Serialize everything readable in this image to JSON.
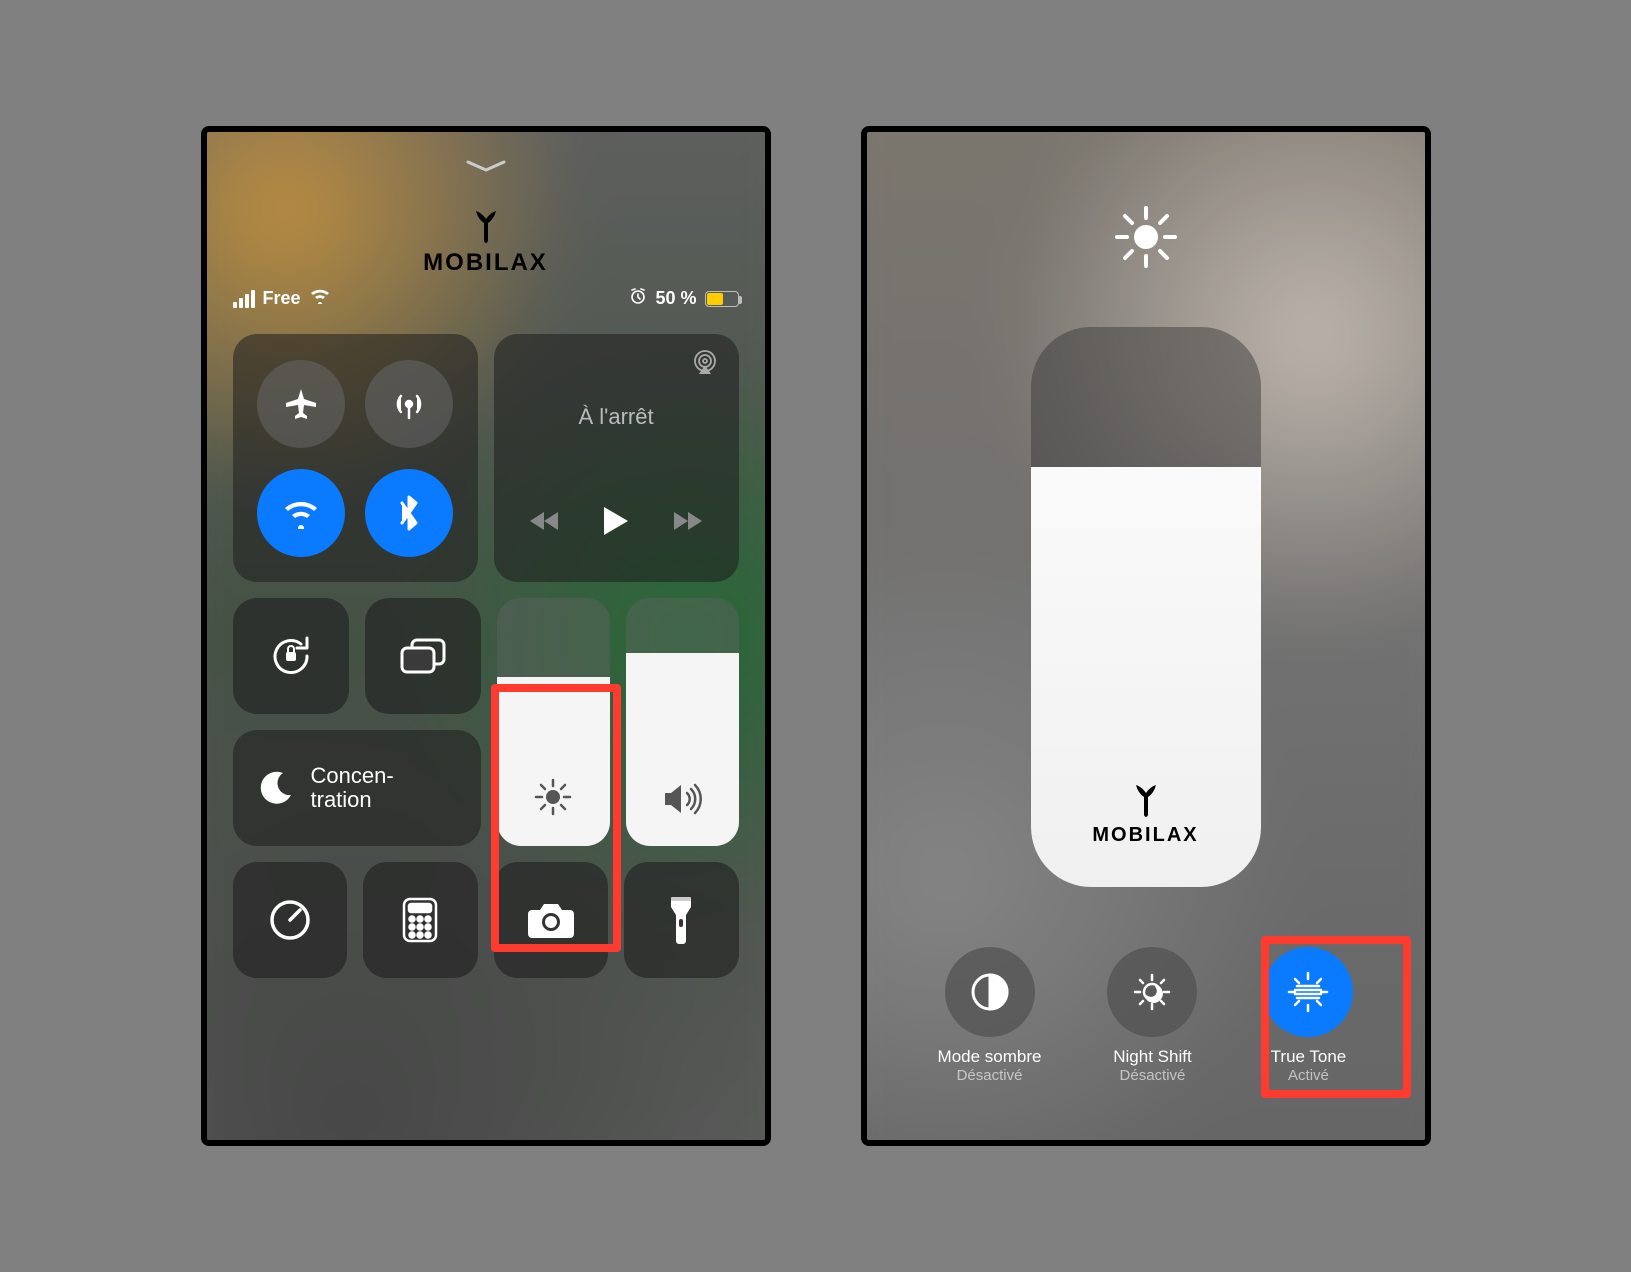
{
  "left": {
    "carrier": "Free",
    "battery_pct": "50 %",
    "media_title": "À l'arrêt",
    "focus_label": "Concen-\ntration",
    "logo_text": "MOBILAX",
    "brightness_fill_pct": 68,
    "volume_fill_pct": 78
  },
  "right": {
    "logo_text": "MOBILAX",
    "brightness_fill_pct": 75,
    "items": [
      {
        "label": "Mode sombre",
        "status": "Désactivé"
      },
      {
        "label": "Night Shift",
        "status": "Désactivé"
      },
      {
        "label": "True Tone",
        "status": "Activé"
      }
    ]
  }
}
